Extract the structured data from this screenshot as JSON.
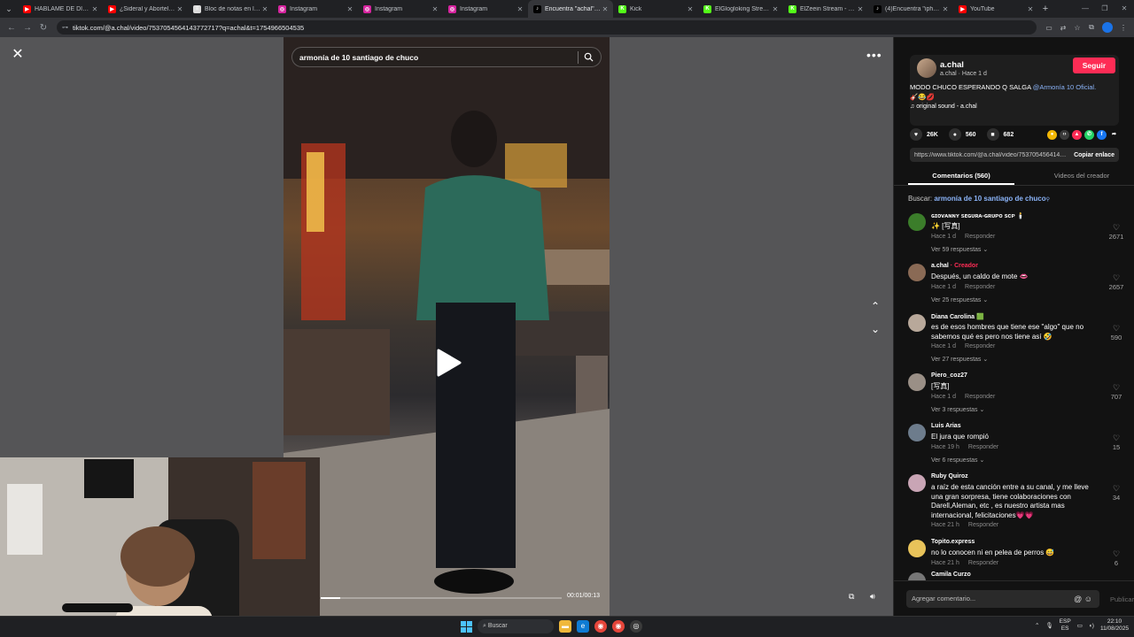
{
  "tabs": [
    {
      "title": "HÁBLAME DE DINERO |",
      "icon": "youtube-icon",
      "color": "#ff0000",
      "glyph": "▶"
    },
    {
      "title": "¿Sideral y Abortelo, u",
      "icon": "youtube-icon",
      "color": "#ff0000",
      "glyph": "▶"
    },
    {
      "title": "Bloc de notas en línea",
      "icon": "notepad-icon",
      "color": "#dcdcdc",
      "glyph": "≡"
    },
    {
      "title": "Instagram",
      "icon": "instagram-icon",
      "color": "#d6249f",
      "glyph": "◎"
    },
    {
      "title": "Instagram",
      "icon": "instagram-icon",
      "color": "#d6249f",
      "glyph": "◎"
    },
    {
      "title": "Instagram",
      "icon": "instagram-icon",
      "color": "#d6249f",
      "glyph": "◎"
    },
    {
      "title": "Encuentra \"achal\" en Ti",
      "icon": "tiktok-icon",
      "color": "#000000",
      "glyph": "♪",
      "active": true
    },
    {
      "title": "Kick",
      "icon": "kick-icon",
      "color": "#53fc18",
      "glyph": "K"
    },
    {
      "title": "ElGlogloking Stream -",
      "icon": "kick-icon",
      "color": "#53fc18",
      "glyph": "K"
    },
    {
      "title": "ElZeein Stream - Watc",
      "icon": "kick-icon",
      "color": "#53fc18",
      "glyph": "K"
    },
    {
      "title": "(4)Encuentra \"iphone",
      "icon": "tiktok-icon",
      "color": "#000000",
      "glyph": "♪"
    },
    {
      "title": "YouTube",
      "icon": "youtube-icon",
      "color": "#ff0000",
      "glyph": "▶"
    }
  ],
  "address": {
    "url": "tiktok.com/@a.chal/video/7537054564143772717?q=achal&t=1754966504535"
  },
  "video": {
    "search_query": "armonía de 10 santiago de chuco",
    "time": "00:01/00:13",
    "progress": 0.08
  },
  "post": {
    "author": "a.chal",
    "author_sub": "a.chal · Hace 1 d",
    "follow_label": "Seguir",
    "desc_text": "MODO CHUCO ESPERANDO Q SALGA ",
    "desc_mention": "@Armonía 10 Oficial.",
    "desc_emoji": "🎸😂💋",
    "sound": "original sound - a.chal",
    "likes": "26K",
    "comments": "560",
    "saves": "682",
    "link": "https://www.tiktok.com/@a.chal/video/7537054564143772717",
    "copy_label": "Copiar enlace"
  },
  "panel_tabs": {
    "comments": "Comentarios (560)",
    "creator": "Videos del creador"
  },
  "search_hint": {
    "prefix": "Buscar: ",
    "query": "armonía de 10 santiago de chuco"
  },
  "comment_list": [
    {
      "name": "ɢɪᴏᴠᴀɴɴʏ sᴇɢᴜʀᴀ-ɢʀᴜᴘᴏ sᴄᴘ 🕯️",
      "text": "✨ [写真]",
      "time": "Hace 1 d",
      "reply": "Responder",
      "replies": "Ver 59 respuestas ⌄",
      "likes": "2671",
      "avatar": "#3b7d2a"
    },
    {
      "name": "a.chal",
      "creator": " · Creador",
      "text": "Después, un caldo de mote 👄",
      "time": "Hace 1 d",
      "reply": "Responder",
      "replies": "Ver 25 respuestas ⌄",
      "likes": "2657",
      "avatar": "#8a6a55"
    },
    {
      "name": "Diana Carolina 🟩",
      "text": "es de esos hombres que tiene ese \"algo\" que no sabemos qué es pero nos tiene así 🤣",
      "time": "Hace 1 d",
      "reply": "Responder",
      "replies": "Ver 27 respuestas ⌄",
      "likes": "590",
      "avatar": "#b8a89a"
    },
    {
      "name": "Piero_coz27",
      "text": "[写真]",
      "time": "Hace 1 d",
      "reply": "Responder",
      "replies": "Ver 3 respuestas ⌄",
      "likes": "707",
      "avatar": "#9a8f86"
    },
    {
      "name": "Luis Arias",
      "text": "El jura que rompió",
      "time": "Hace 19 h",
      "reply": "Responder",
      "replies": "Ver 6 respuestas ⌄",
      "likes": "15",
      "avatar": "#6d7c8c"
    },
    {
      "name": "Ruby Quiroz",
      "text": "a raíz de esta canción entre a su canal, y me lleve una gran sorpresa, tiene colaboraciones con Darell,Aleman, etc , es nuestro artista mas internacional, felicitaciones💗💗",
      "time": "Hace 21 h",
      "reply": "Responder",
      "replies": "",
      "likes": "34",
      "avatar": "#c9a5b5"
    },
    {
      "name": "Topito.express",
      "text": "no lo conocen ni en pelea de perros 😅",
      "time": "Hace 21 h",
      "reply": "Responder",
      "replies": "",
      "likes": "6",
      "avatar": "#e8c35a"
    },
    {
      "name": "Camila Curzo",
      "text": "",
      "time": "",
      "reply": "",
      "replies": "",
      "likes": "",
      "avatar": "#777777"
    }
  ],
  "comment_input": {
    "placeholder": "Agregar comentario...",
    "publish": "Publicar"
  },
  "taskbar": {
    "search": "Buscar",
    "lang": "ESP",
    "lang2": "ES",
    "time": "22:10",
    "date": "11/08/2025"
  },
  "colors": {
    "accent": "#fe2c55",
    "mention": "#8bb4f9",
    "panel_bg": "#121212"
  }
}
